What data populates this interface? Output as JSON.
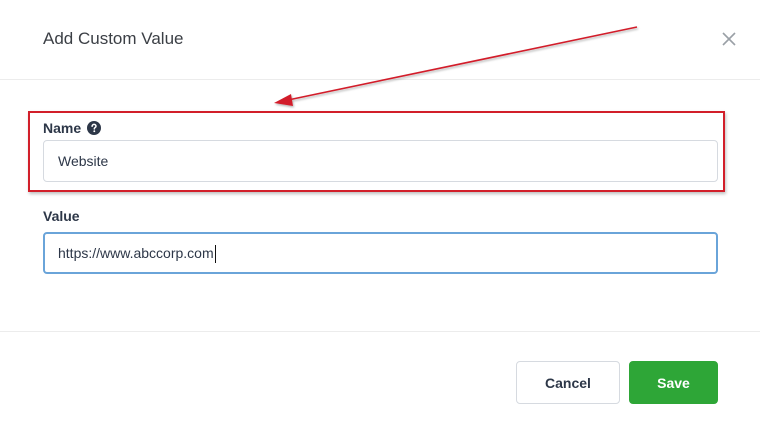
{
  "dialog": {
    "title": "Add Custom Value",
    "close_icon": "close-icon"
  },
  "form": {
    "name_label": "Name",
    "name_help_icon": "question-circle-icon",
    "name_value": "Website",
    "value_label": "Value",
    "value_value": "https://www.abccorp.com"
  },
  "footer": {
    "cancel_label": "Cancel",
    "save_label": "Save"
  },
  "colors": {
    "save_button": "#2ea637",
    "focus_border": "#6aa4d9",
    "annotation": "#d21f2a"
  }
}
